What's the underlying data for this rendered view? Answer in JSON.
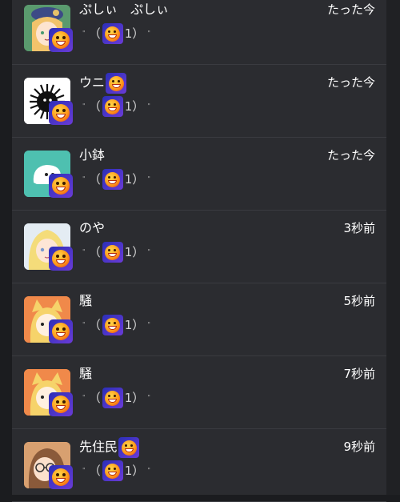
{
  "messages": [
    {
      "name": "ぷしぃ　ぷしぃ",
      "name_has_emoji": false,
      "time": "たった今",
      "open": "（",
      "close": "1）",
      "quote_l": "\"",
      "quote_r": "\"",
      "avatar": "anime-girl-hat-avatar"
    },
    {
      "name": "ウニ",
      "name_has_emoji": true,
      "time": "たった今",
      "open": "（",
      "close": "1）",
      "quote_l": "\"",
      "quote_r": "\"",
      "avatar": "urchin-avatar"
    },
    {
      "name": "小鉢",
      "name_has_emoji": false,
      "time": "たった今",
      "open": "（",
      "close": "1）",
      "quote_l": "\"",
      "quote_r": "\"",
      "avatar": "blob-avatar"
    },
    {
      "name": "のや",
      "name_has_emoji": false,
      "time": "3秒前",
      "open": "（",
      "close": "1）",
      "quote_l": "\"",
      "quote_r": "\"",
      "avatar": "blonde-girl-avatar"
    },
    {
      "name": "騒",
      "name_has_emoji": false,
      "time": "5秒前",
      "open": "（",
      "close": "1）",
      "quote_l": "\"",
      "quote_r": "\"",
      "avatar": "fox-girl-avatar"
    },
    {
      "name": "騒",
      "name_has_emoji": false,
      "time": "7秒前",
      "open": "（",
      "close": "1）",
      "quote_l": "\"",
      "quote_r": "\"",
      "avatar": "fox-girl-avatar"
    },
    {
      "name": "先住民",
      "name_has_emoji": true,
      "time": "9秒前",
      "open": "（",
      "close": "1）",
      "quote_l": "\"",
      "quote_r": "\"",
      "avatar": "glasses-girl-avatar"
    }
  ],
  "colors": {
    "panel": "#2b2c30",
    "background": "#1b1c1f",
    "badge": "#3b34c8"
  },
  "icons": {
    "reaction": "grinning-face-emoji-icon"
  }
}
